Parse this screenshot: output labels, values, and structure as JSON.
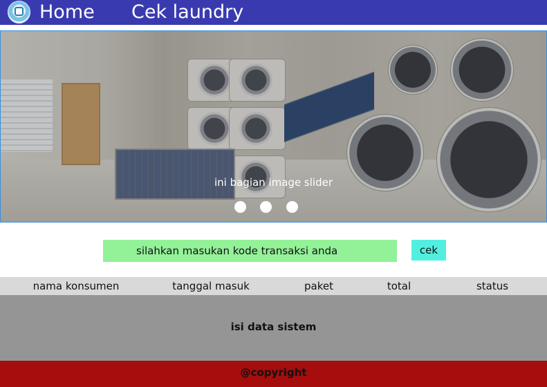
{
  "nav": {
    "logo_icon": "laundry-logo-icon",
    "home_label": "Home",
    "cek_label": "Cek laundry",
    "bg_color": "#3a3ab0"
  },
  "slider": {
    "caption": "ini bagian image slider",
    "dot_count": 3
  },
  "search": {
    "placeholder": "silahkan masukan kode transaksi anda",
    "button_label": "cek"
  },
  "table": {
    "columns": [
      "nama konsumen",
      "tanggal masuk",
      "paket",
      "total",
      "status"
    ],
    "body_text": "isi data sistem"
  },
  "footer": {
    "text": "@copyright",
    "bg_color": "#a60d0d"
  }
}
